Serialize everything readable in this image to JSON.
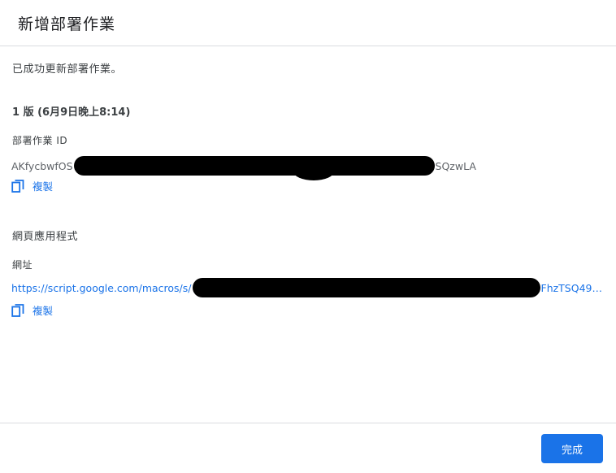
{
  "dialog": {
    "title": "新增部署作業"
  },
  "body": {
    "success_message": "已成功更新部署作業。",
    "version": "1 版 (6月9日晚上8:14)",
    "deployment_id": {
      "label": "部署作業 ID",
      "value_prefix": "AKfycbwfOS",
      "value_suffix": "SQzwLA",
      "copy_label": "複製"
    },
    "web_app": {
      "section_title": "網頁應用程式",
      "url_label": "網址",
      "url_prefix": "https://script.google.com/macros/s/",
      "url_suffix": "FhzTSQ49…",
      "copy_label": "複製"
    }
  },
  "footer": {
    "done_label": "完成"
  },
  "colors": {
    "accent": "#1a73e8",
    "divider": "#dadce0",
    "text": "#3c4043",
    "redaction": "#000000"
  }
}
